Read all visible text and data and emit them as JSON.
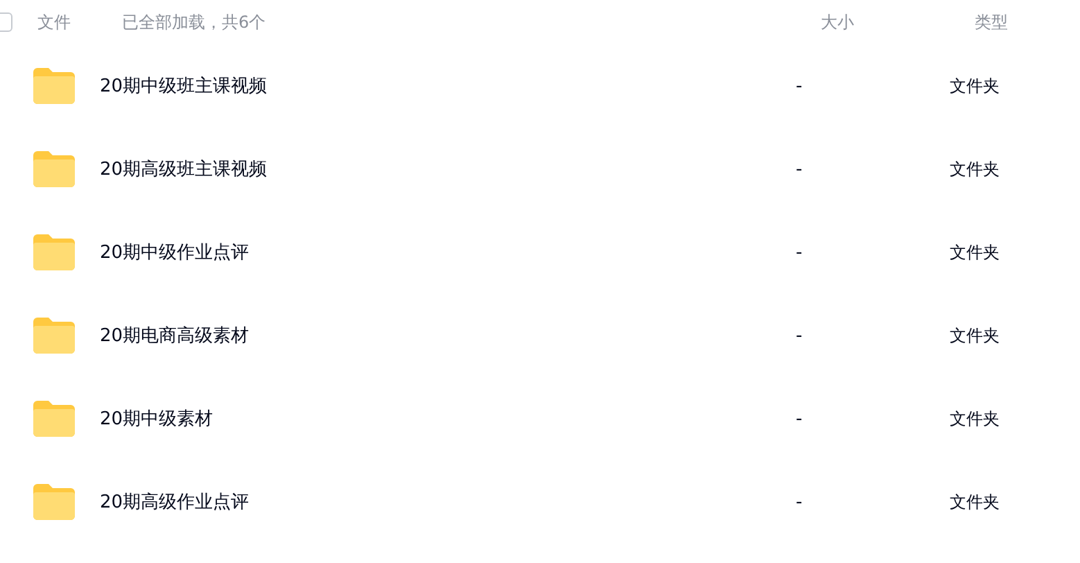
{
  "header": {
    "select_all": {
      "checked": false
    },
    "name": "文件",
    "status": "已全部加载，共6个",
    "size": "大小",
    "type": "类型"
  },
  "rows": [
    {
      "name": "20期中级班主课视频",
      "size": "-",
      "type": "文件夹"
    },
    {
      "name": "20期高级班主课视频",
      "size": "-",
      "type": "文件夹"
    },
    {
      "name": "20期中级作业点评",
      "size": "-",
      "type": "文件夹"
    },
    {
      "name": "20期电商高级素材",
      "size": "-",
      "type": "文件夹"
    },
    {
      "name": "20期中级素材",
      "size": "-",
      "type": "文件夹"
    },
    {
      "name": "20期高级作业点评",
      "size": "-",
      "type": "文件夹"
    }
  ]
}
